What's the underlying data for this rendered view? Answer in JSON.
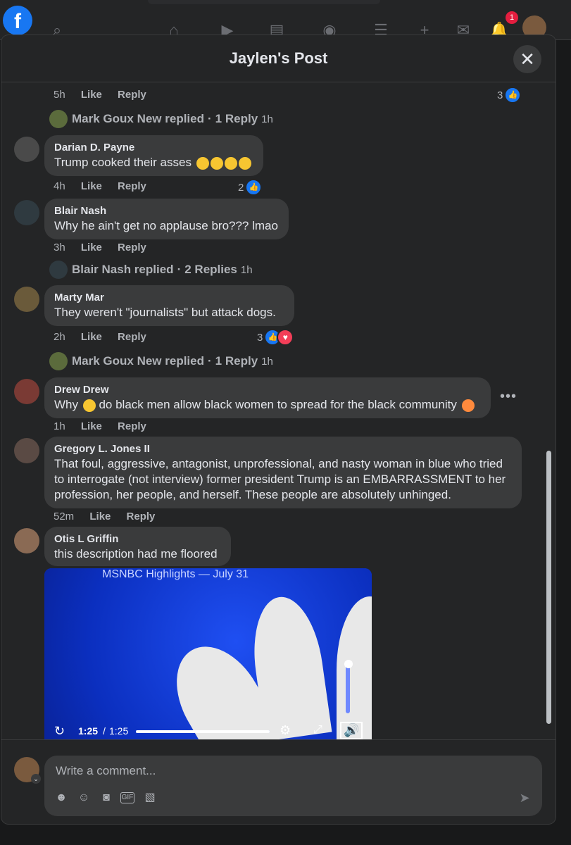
{
  "topbar": {
    "notification_count": "1"
  },
  "modal": {
    "title": "Jaylen's Post",
    "close_icon": "close-icon"
  },
  "comments": [
    {
      "meta": {
        "time": "5h",
        "like": "Like",
        "reply": "Reply"
      },
      "reaction_count": "3",
      "reactions": [
        "like"
      ]
    },
    {
      "author": "Darian D. Payne",
      "text": "Trump cooked their asses",
      "emojis": [
        "laughing-emoji",
        "laughing-emoji",
        "rofl-emoji",
        "rofl-emoji"
      ],
      "meta": {
        "time": "4h",
        "like": "Like",
        "reply": "Reply"
      },
      "reaction_count": "2",
      "reactions": [
        "like"
      ]
    },
    {
      "author": "Blair Nash",
      "text": "Why he ain't get no applause bro??? lmao",
      "meta": {
        "time": "3h",
        "like": "Like",
        "reply": "Reply"
      }
    },
    {
      "author": "Marty Mar",
      "text": "They weren't \"journalists\" but attack dogs.",
      "meta": {
        "time": "2h",
        "like": "Like",
        "reply": "Reply"
      },
      "reaction_count": "3",
      "reactions": [
        "like",
        "love"
      ]
    },
    {
      "author": "Drew Drew",
      "text_before": "Why",
      "text_after": "do black men allow black women to spread for the black community",
      "emojis": [
        "thinking-emoji",
        "clown-emoji"
      ],
      "meta": {
        "time": "1h",
        "like": "Like",
        "reply": "Reply"
      }
    },
    {
      "author": "Gregory L. Jones II",
      "text": "That foul, aggressive, antagonist, unprofessional, and nasty woman in blue who tried to interrogate (not interview) former president Trump is an EMBARRASSMENT to her profession, her people, and herself. These people are absolutely unhinged.",
      "meta": {
        "time": "52m",
        "like": "Like",
        "reply": "Reply"
      }
    },
    {
      "author": "Otis L Griffin",
      "text": "this description had me floored"
    }
  ],
  "replied_lines": [
    {
      "name": "Mark Goux New replied",
      "count": "1 Reply",
      "time": "1h"
    },
    {
      "name": "Blair Nash replied",
      "count": "2 Replies",
      "time": "1h"
    },
    {
      "name": "Mark Goux New replied",
      "count": "1 Reply",
      "time": "1h"
    }
  ],
  "video": {
    "title": "MSNBC Highlights — July 31",
    "current_time": "1:25",
    "separator": "/",
    "duration": "1:25",
    "progress": 1.0
  },
  "composer": {
    "placeholder": "Write a comment...",
    "tools": [
      "avatar-sticker-icon",
      "emoji-icon",
      "camera-icon",
      "gif-icon",
      "sticker-icon"
    ],
    "send_icon": "send-icon"
  }
}
